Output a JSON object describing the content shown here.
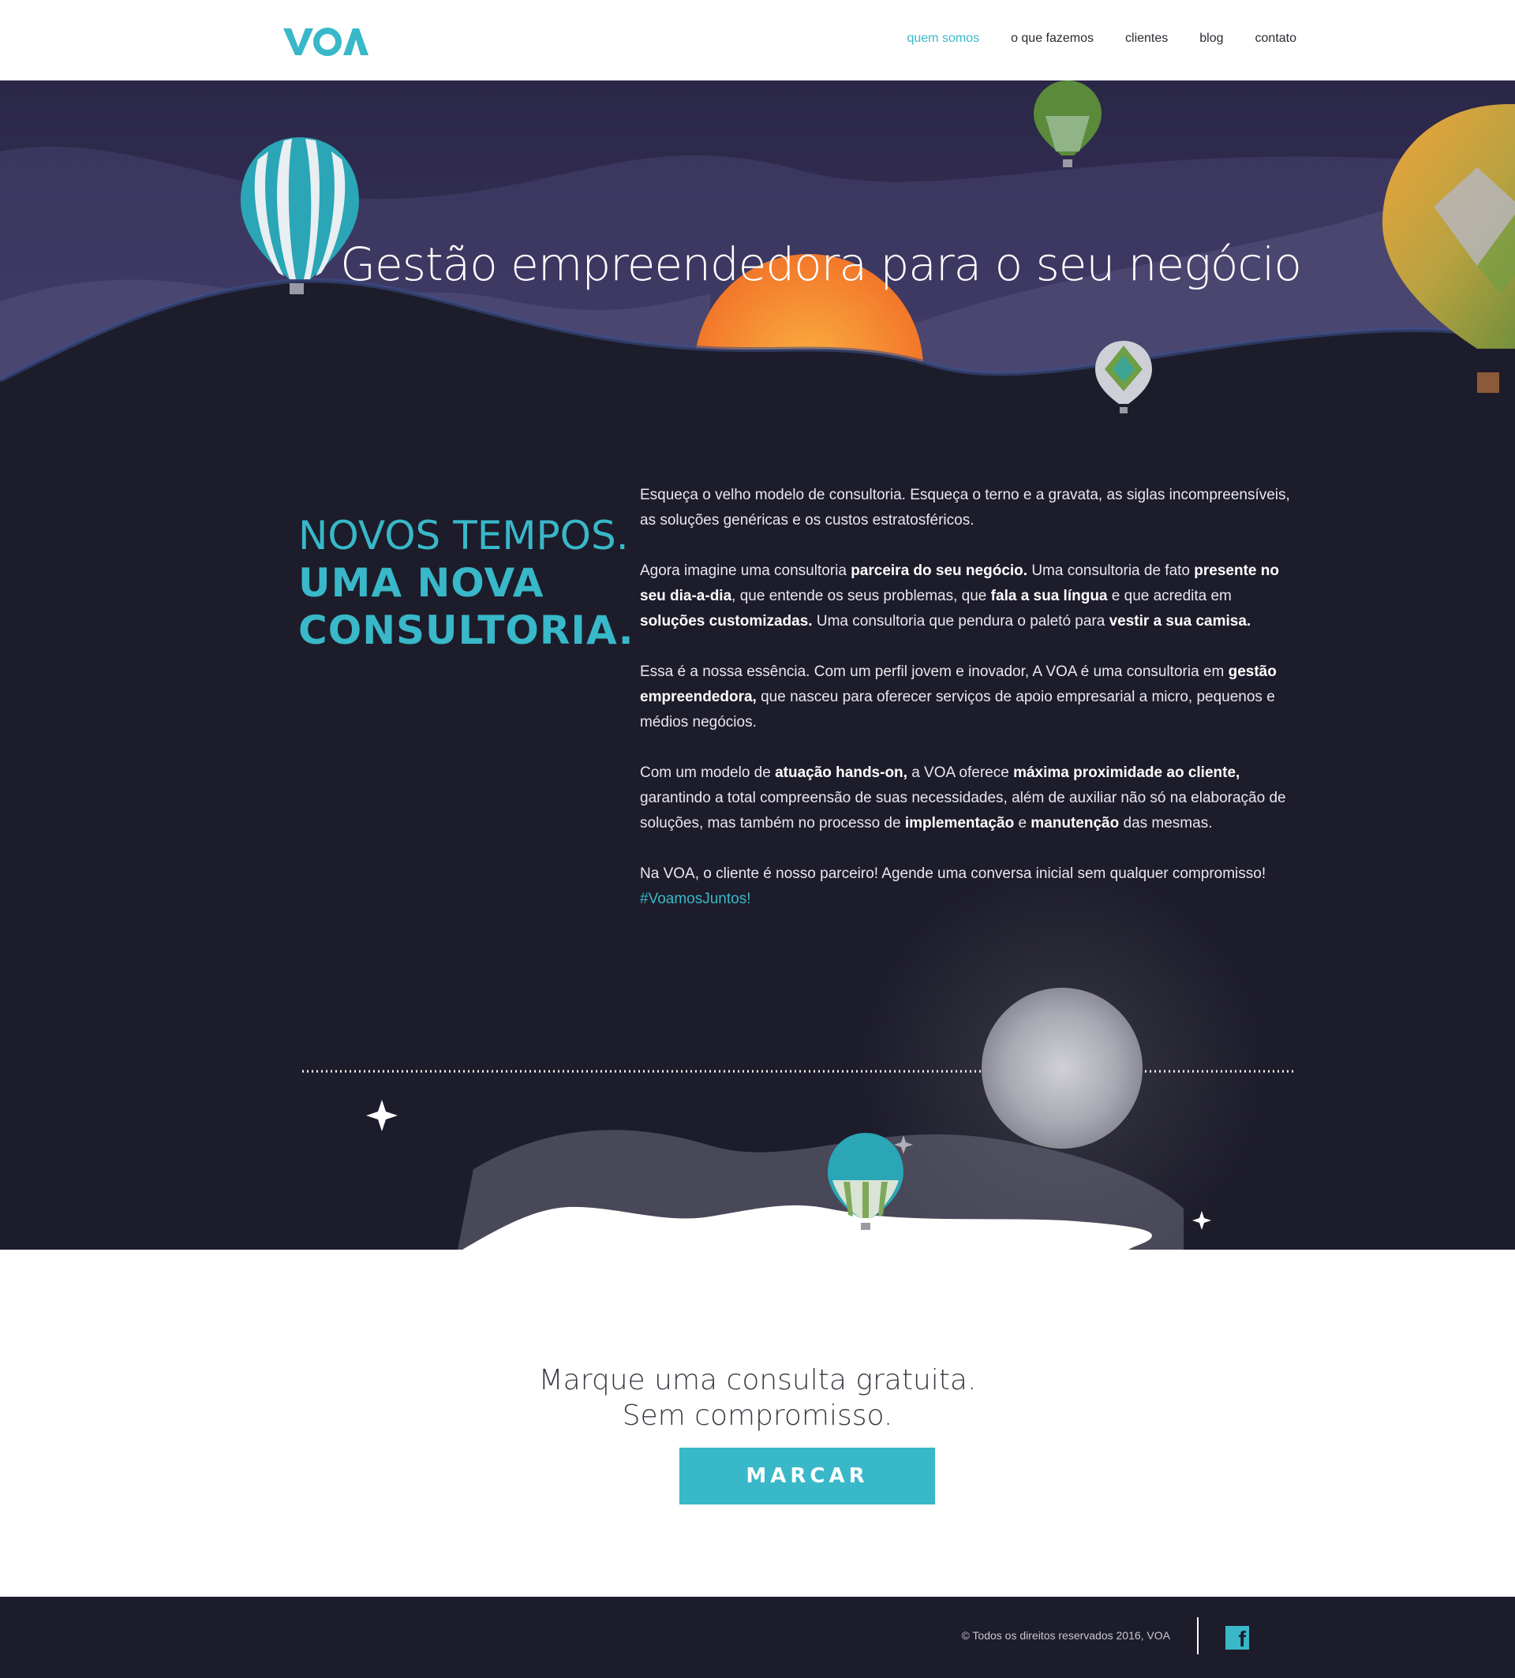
{
  "header": {
    "logo_text": "VOA",
    "nav": [
      {
        "label": "quem somos",
        "active": true
      },
      {
        "label": "o que fazemos",
        "active": false
      },
      {
        "label": "clientes",
        "active": false
      },
      {
        "label": "blog",
        "active": false
      },
      {
        "label": "contato",
        "active": false
      }
    ]
  },
  "hero": {
    "title": "Gestão empreendedora para o seu negócio"
  },
  "about": {
    "heading_line1": "NOVOS TEMPOS.",
    "heading_line2": "UMA NOVA",
    "heading_line3": "CONSULTORIA.",
    "p1": "Esqueça o velho modelo de consultoria. Esqueça o terno e a gravata, as siglas incompreensíveis, as soluções genéricas e os custos estratosféricos.",
    "p2": [
      {
        "t": "Agora imagine uma consultoria ",
        "b": false
      },
      {
        "t": "parceira do seu negócio.",
        "b": true
      },
      {
        "t": " Uma consultoria de fato ",
        "b": false
      },
      {
        "t": "presente no seu dia-a-dia",
        "b": true
      },
      {
        "t": ", que entende os seus problemas, que ",
        "b": false
      },
      {
        "t": "fala a sua língua",
        "b": true
      },
      {
        "t": " e que acredita em ",
        "b": false
      },
      {
        "t": "soluções customizadas.",
        "b": true
      },
      {
        "t": " Uma consultoria que pendura o paletó para ",
        "b": false
      },
      {
        "t": "vestir a sua camisa.",
        "b": true
      }
    ],
    "p3": [
      {
        "t": "Essa é a nossa essência. Com um perfil jovem e inovador, A VOA é uma consultoria em ",
        "b": false
      },
      {
        "t": "gestão empreendedora,",
        "b": true
      },
      {
        "t": " que nasceu para oferecer serviços de apoio empresarial a micro, pequenos e médios negócios.",
        "b": false
      }
    ],
    "p4": [
      {
        "t": "Com um modelo de ",
        "b": false
      },
      {
        "t": "atuação hands-on,",
        "b": true
      },
      {
        "t": " a VOA oferece ",
        "b": false
      },
      {
        "t": "máxima proximidade ao cliente,",
        "b": true
      },
      {
        "t": " garantindo a total compreensão de suas necessidades, além de auxiliar não só na elaboração de soluções, mas também no processo de ",
        "b": false
      },
      {
        "t": "implementação",
        "b": true
      },
      {
        "t": " e ",
        "b": false
      },
      {
        "t": "manutenção",
        "b": true
      },
      {
        "t": " das mesmas.",
        "b": false
      }
    ],
    "p5": "Na VOA, o cliente é nosso parceiro! Agende uma conversa inicial sem qualquer compromisso!",
    "hashtag": "#VoamosJuntos!"
  },
  "cta": {
    "line1": "Marque uma consulta gratuita.",
    "line2": "Sem compromisso.",
    "button_label": "MARCAR"
  },
  "footer": {
    "copyright": "© Todos os direitos reservados 2016, VOA",
    "facebook_icon": "facebook-icon"
  },
  "colors": {
    "accent": "#38b8c9",
    "dark_bg": "#1d1c2a",
    "sky": "#2d2a4d",
    "sun": "#f68a2e"
  }
}
